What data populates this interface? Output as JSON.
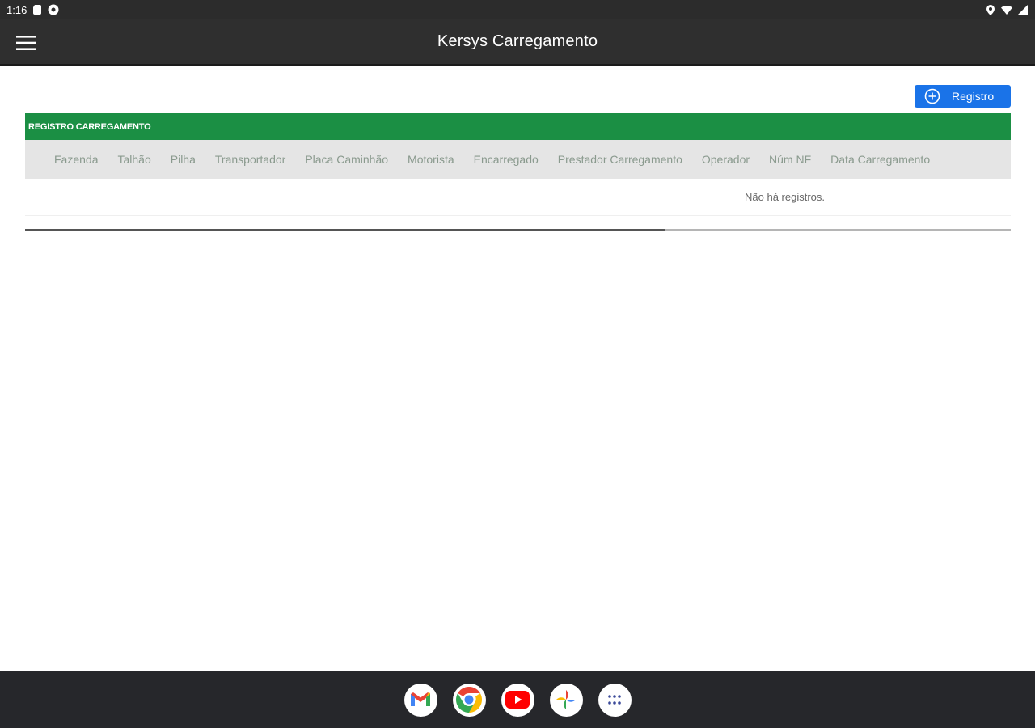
{
  "status_bar": {
    "time": "1:16"
  },
  "app_bar": {
    "title": "Kersys Carregamento"
  },
  "actions": {
    "add_label": "Registro"
  },
  "table": {
    "title": "REGISTRO CARREGAMENTO",
    "columns": [
      "Fazenda",
      "Talhão",
      "Pilha",
      "Transportador",
      "Placa Caminhão",
      "Motorista",
      "Encarregado",
      "Prestador Carregamento",
      "Operador",
      "Núm NF",
      "Data Carregamento"
    ],
    "empty_message": "Não há registros.",
    "scroll_fraction": 0.65
  },
  "dock": {
    "apps": [
      "gmail-icon",
      "chrome-icon",
      "youtube-icon",
      "photos-icon",
      "app-drawer-icon"
    ]
  },
  "colors": {
    "header_green": "#1b8f44",
    "button_blue": "#1a73e8",
    "app_bar": "#2f2f2f"
  }
}
